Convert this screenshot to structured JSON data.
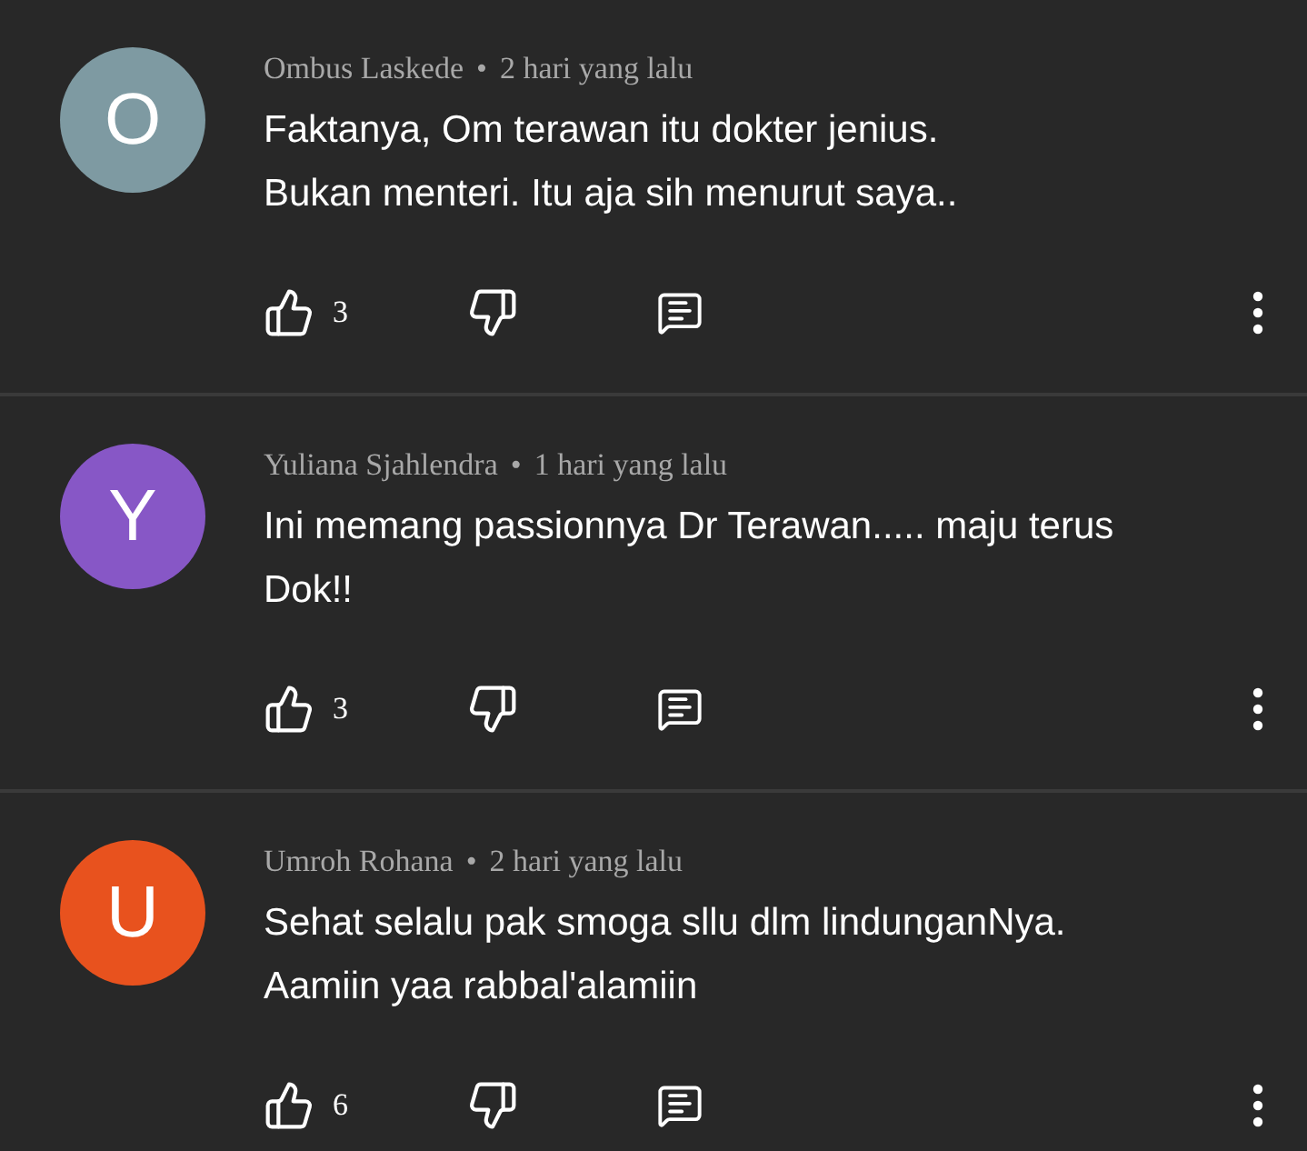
{
  "comments": [
    {
      "avatar_letter": "O",
      "color": "#7e9aa2",
      "author": "Ombus Laskede",
      "separator": "•",
      "time": "2 hari yang lalu",
      "text_lines": [
        "Faktanya, Om terawan itu dokter jenius.",
        "Bukan menteri. Itu aja sih menurut saya.."
      ],
      "likes": "3"
    },
    {
      "avatar_letter": "Y",
      "color": "#8757c6",
      "author": "Yuliana Sjahlendra",
      "separator": "•",
      "time": "1 hari yang lalu",
      "text_lines": [
        "Ini memang passionnya Dr Terawan..... maju terus",
        "Dok!!"
      ],
      "likes": "3"
    },
    {
      "avatar_letter": "U",
      "color": "#e8521e",
      "author": "Umroh Rohana",
      "separator": "•",
      "time": "2 hari yang lalu",
      "text_lines": [
        "Sehat selalu pak smoga sllu dlm lindunganNya.",
        "Aamiin yaa rabbal'alamiin"
      ],
      "likes": "6"
    }
  ]
}
